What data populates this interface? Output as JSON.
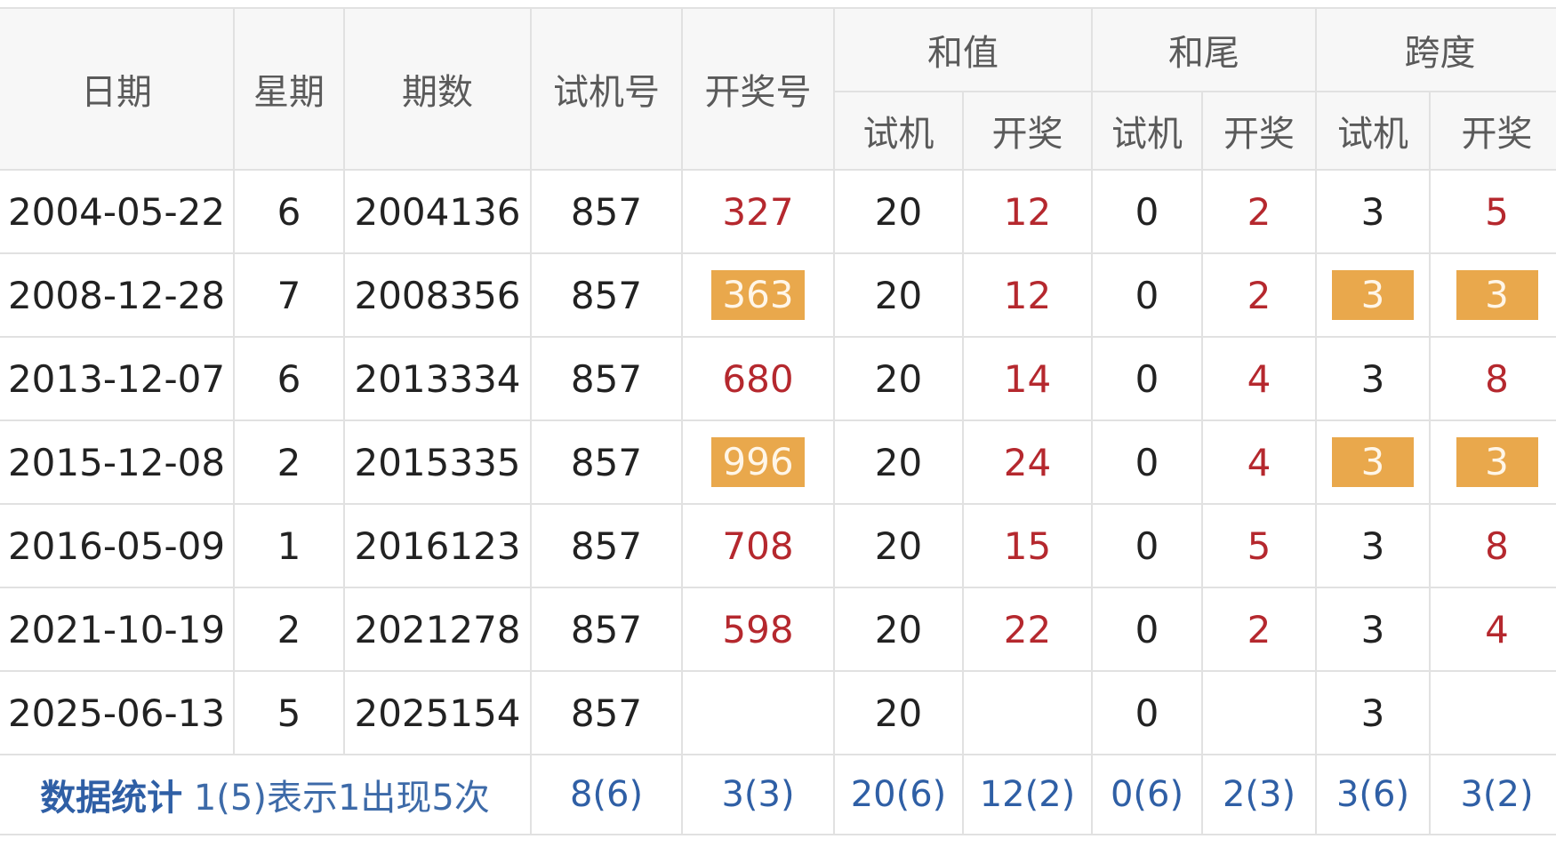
{
  "headers": {
    "date": "日期",
    "weekday": "星期",
    "issue": "期数",
    "trial": "试机号",
    "draw": "开奖号",
    "sum_group": "和值",
    "tail_group": "和尾",
    "span_group": "跨度",
    "sub_trial": "试机",
    "sub_draw": "开奖"
  },
  "rows": [
    {
      "date": "2004-05-22",
      "weekday": "6",
      "issue": "2004136",
      "trial": "857",
      "draw": "327",
      "sum_trial": "20",
      "sum_draw": "12",
      "tail_trial": "0",
      "tail_draw": "2",
      "span_trial": "3",
      "span_draw": "5",
      "draw_hl": false,
      "span_hl": false
    },
    {
      "date": "2008-12-28",
      "weekday": "7",
      "issue": "2008356",
      "trial": "857",
      "draw": "363",
      "sum_trial": "20",
      "sum_draw": "12",
      "tail_trial": "0",
      "tail_draw": "2",
      "span_trial": "3",
      "span_draw": "3",
      "draw_hl": true,
      "span_hl": true
    },
    {
      "date": "2013-12-07",
      "weekday": "6",
      "issue": "2013334",
      "trial": "857",
      "draw": "680",
      "sum_trial": "20",
      "sum_draw": "14",
      "tail_trial": "0",
      "tail_draw": "4",
      "span_trial": "3",
      "span_draw": "8",
      "draw_hl": false,
      "span_hl": false
    },
    {
      "date": "2015-12-08",
      "weekday": "2",
      "issue": "2015335",
      "trial": "857",
      "draw": "996",
      "sum_trial": "20",
      "sum_draw": "24",
      "tail_trial": "0",
      "tail_draw": "4",
      "span_trial": "3",
      "span_draw": "3",
      "draw_hl": true,
      "span_hl": true
    },
    {
      "date": "2016-05-09",
      "weekday": "1",
      "issue": "2016123",
      "trial": "857",
      "draw": "708",
      "sum_trial": "20",
      "sum_draw": "15",
      "tail_trial": "0",
      "tail_draw": "5",
      "span_trial": "3",
      "span_draw": "8",
      "draw_hl": false,
      "span_hl": false
    },
    {
      "date": "2021-10-19",
      "weekday": "2",
      "issue": "2021278",
      "trial": "857",
      "draw": "598",
      "sum_trial": "20",
      "sum_draw": "22",
      "tail_trial": "0",
      "tail_draw": "2",
      "span_trial": "3",
      "span_draw": "4",
      "draw_hl": false,
      "span_hl": false
    },
    {
      "date": "2025-06-13",
      "weekday": "5",
      "issue": "2025154",
      "trial": "857",
      "draw": "",
      "sum_trial": "20",
      "sum_draw": "",
      "tail_trial": "0",
      "tail_draw": "",
      "span_trial": "3",
      "span_draw": "",
      "draw_hl": false,
      "span_hl": false
    }
  ],
  "stats": {
    "title": "数据统计",
    "note": "1(5)表示1出现5次",
    "trial": "8(6)",
    "draw": "3(3)",
    "sum_trial": "20(6)",
    "sum_draw": "12(2)",
    "tail_trial": "0(6)",
    "tail_draw": "2(3)",
    "span_trial": "3(6)",
    "span_draw": "3(2)"
  },
  "colors": {
    "draw_text": "#b5282e",
    "highlight_bg": "#e9a84c",
    "stat_text": "#2f5fa5",
    "header_bg": "#f7f7f7",
    "border": "#e1e1e1"
  }
}
